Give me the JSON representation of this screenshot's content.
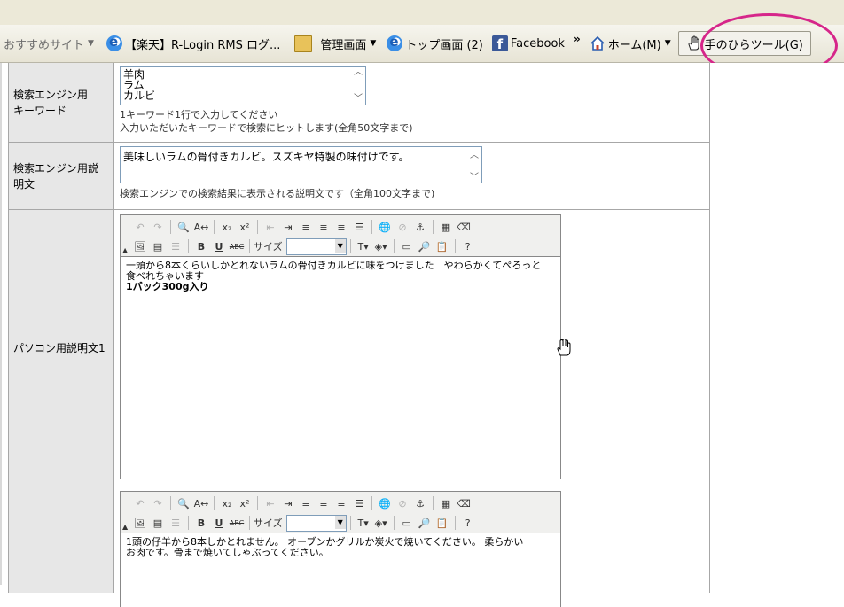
{
  "bookmarks": [
    {
      "label": "おすすめサイト",
      "icon": "dropdown-text",
      "has_dropdown": true
    },
    {
      "label": "【楽天】R-Login RMS ログ...",
      "icon": "ie-page-icon"
    },
    {
      "label": "管理画面",
      "icon": "folder-icon",
      "has_dropdown": true
    },
    {
      "label": "トップ画面 (2)",
      "icon": "ie-page-icon"
    },
    {
      "label": "Facebook",
      "icon": "facebook-icon"
    }
  ],
  "chevron": "»",
  "home_button": {
    "label": "ホーム(M)",
    "icon": "home-icon"
  },
  "hand_tool": {
    "label": "手のひらツール(G)",
    "icon": "hand-icon"
  },
  "highlight_color": "#d6268a",
  "form": {
    "keywords": {
      "label": "検索エンジン用キーワード",
      "label_lines": [
        "検索エンジン用",
        "キーワード"
      ],
      "options": [
        "羊肉",
        "ラム",
        "カルビ"
      ],
      "note1": "1キーワード1行で入力してください",
      "note2": "入力いただいたキーワードで検索にヒットします(全角50文字まで)"
    },
    "description": {
      "label_lines": [
        "検索エンジン用説",
        "明文"
      ],
      "value": "美味しいラムの骨付きカルビ。スズキヤ特製の味付けです。",
      "note": "検索エンジンでの検索結果に表示される説明文です（全角100文字まで)"
    },
    "pc_desc1": {
      "label": "パソコン用説明文1",
      "toolbar_size_label": "サイズ",
      "bold_label": "B",
      "underline_label": "U",
      "strike_label": "ABC",
      "line1": "一頭から8本くらいしかとれないラムの骨付きカルビに味をつけました　やわらかくてぺろっと",
      "line2": "食べれちゃいます",
      "line3": "1パック300g入り"
    },
    "pc_desc2": {
      "label": "",
      "toolbar_size_label": "サイズ",
      "bold_label": "B",
      "underline_label": "U",
      "strike_label": "ABC",
      "line1": "1頭の仔羊から8本しかとれません。 オーブンかグリルか炭火で焼いてください。 柔らかい",
      "line2": "お肉です。骨まで焼いてしゃぶってください。"
    }
  }
}
